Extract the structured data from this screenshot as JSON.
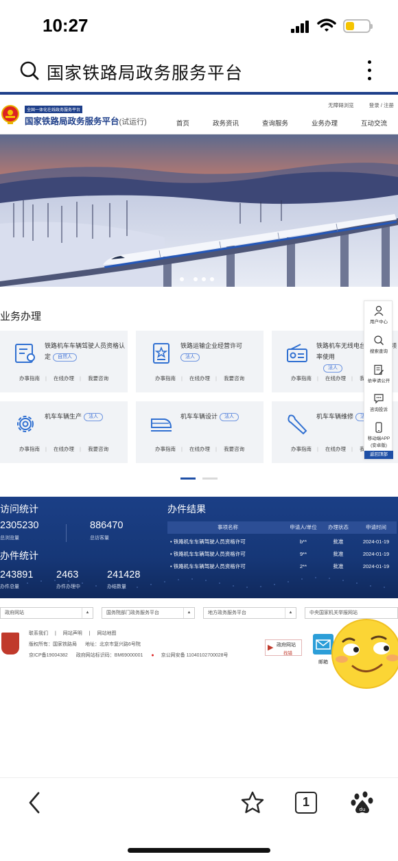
{
  "status_bar": {
    "time": "10:27"
  },
  "browser": {
    "address_text": "国家铁路局政务服务平台",
    "icons": {
      "search": "search-icon",
      "menu": "more-vertical-icon",
      "back": "back-arrow-icon",
      "bookmark": "star-icon",
      "tabs_count": "1",
      "baidu": "baidu-paw-icon"
    }
  },
  "site": {
    "badge": "全国一体化在线政务服务平台",
    "title": "国家铁路局政务服务平台",
    "title_suffix": "(试运行)",
    "util_links": [
      "无障碍浏览",
      "登录 / 注册"
    ],
    "nav": [
      "首页",
      "政务资讯",
      "查询服务",
      "业务办理",
      "互动交流"
    ]
  },
  "services": {
    "title": "业务办理",
    "cards": [
      {
        "title": "铁路机车车辆驾驶人员资格认定",
        "tag": "自然人",
        "links": [
          "办事指南",
          "在线办理",
          "我要咨询"
        ]
      },
      {
        "title": "铁路运输企业经营许可",
        "tag": "法人",
        "links": [
          "办事指南",
          "在线办理",
          "我要咨询"
        ]
      },
      {
        "title": "铁路机车无线电台批及电台频率使用",
        "tag": "法人",
        "links": [
          "办事指南",
          "在线办理",
          "我要咨询"
        ]
      },
      {
        "title": "机车车辆生产",
        "tag": "法人",
        "links": [
          "办事指南",
          "在线办理",
          "我要咨询"
        ]
      },
      {
        "title": "机车车辆设计",
        "tag": "法人",
        "links": [
          "办事指南",
          "在线办理",
          "我要咨询"
        ]
      },
      {
        "title": "机车车辆维修",
        "tag": "法",
        "links": [
          "办事指南",
          "在线办理",
          "我要"
        ]
      }
    ]
  },
  "float_bar": {
    "items": [
      "用户中心",
      "搜索查询",
      "依申请公开",
      "咨询投诉",
      "移动端APP",
      "(安卓版)"
    ],
    "back_to_top": "返回顶部"
  },
  "stats": {
    "visit_title": "访问统计",
    "total_views": "2305230",
    "total_views_label": "总浏览量",
    "total_visitors": "886470",
    "total_visitors_label": "总访客量",
    "handle_title": "办件统计",
    "handle_total": "243891",
    "handle_total_label": "办件总量",
    "handle_in_progress": "2463",
    "handle_in_progress_label": "办件办理中",
    "handle_done": "241428",
    "handle_done_label": "办结数量",
    "result_title": "办件结果",
    "result_headers": [
      "事项名称",
      "申请人/单位",
      "办理状态",
      "申请时间"
    ],
    "result_rows": [
      [
        "铁路机车车辆驾驶人员资格许可",
        "b**",
        "批准",
        "2024-01-19"
      ],
      [
        "铁路机车车辆驾驶人员资格许可",
        "9**",
        "批准",
        "2024-01-19"
      ],
      [
        "铁路机车车辆驾驶人员资格许可",
        "2**",
        "批准",
        "2024-01-19"
      ]
    ]
  },
  "footer": {
    "selects": [
      "政府网站",
      "国务院部门政务服务平台",
      "地方政务服务平台",
      "中央国家机关举报网站"
    ],
    "links": [
      "联系我们",
      "网站声明",
      "网站地图"
    ],
    "copyright": "版权所有：国家铁路局",
    "address": "地址：北京市复兴路6号院",
    "icp": "京ICP备19004382",
    "site_code": "政府网站标识码：BM69000001",
    "police": "京公网安备 11040102700028号",
    "gov_badge_title": "政府网站",
    "gov_badge_sub": "找错",
    "mail_label": "邮箱"
  }
}
